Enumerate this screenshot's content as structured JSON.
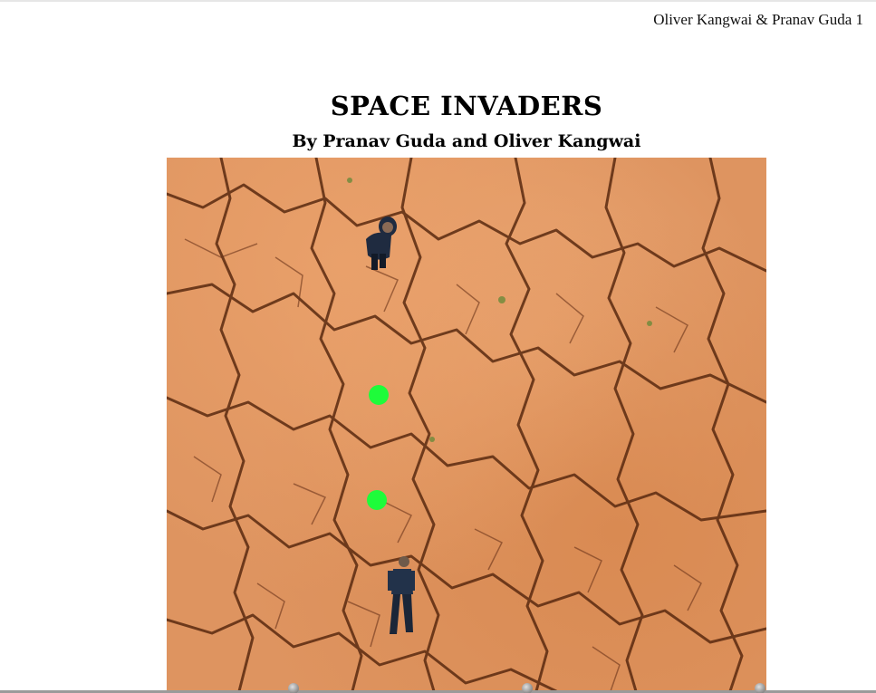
{
  "header": {
    "credit": "Oliver Kangwai & Pranav Guda 1"
  },
  "game": {
    "title": "SPACE INVADERS",
    "subtitle": "By Pranav Guda and Oliver Kangwai",
    "colors": {
      "background": "#de9460",
      "crack": "#5a2a10",
      "bullet": "#1efc3a",
      "enemy_hoodie": "#1f2b40",
      "player_uniform": "#22324a"
    },
    "entities": [
      {
        "name": "enemy-person",
        "icon": "hooded-person-icon"
      },
      {
        "name": "bullet-1",
        "icon": "green-dot-icon"
      },
      {
        "name": "bullet-2",
        "icon": "green-dot-icon"
      },
      {
        "name": "player-person",
        "icon": "standing-person-icon"
      }
    ]
  }
}
